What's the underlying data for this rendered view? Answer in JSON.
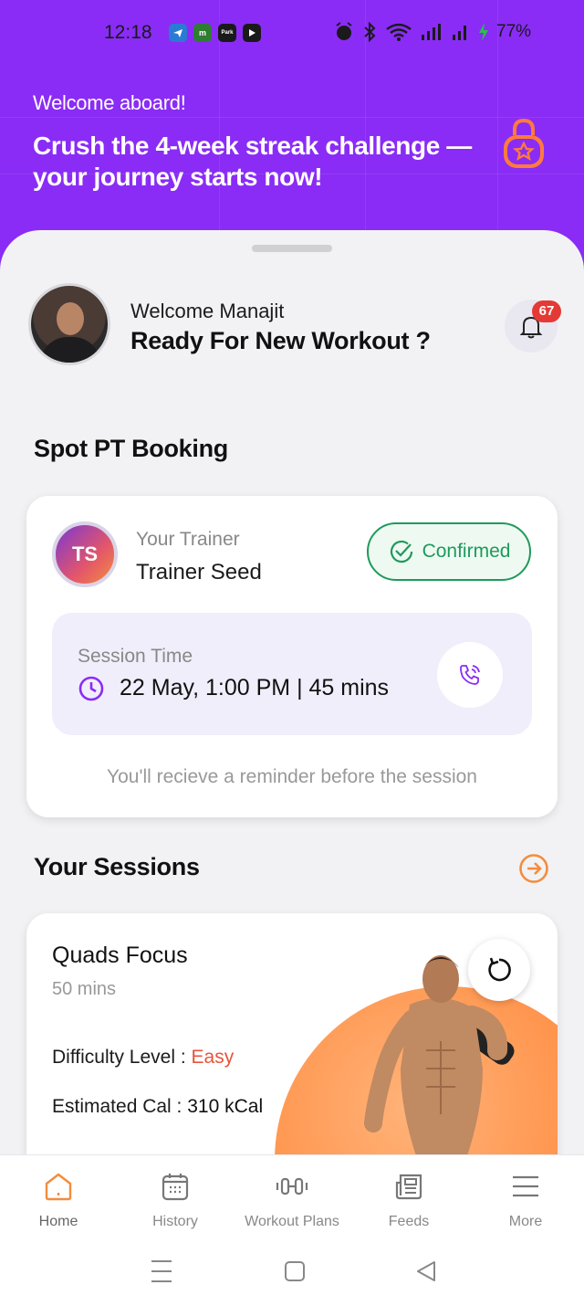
{
  "status_bar": {
    "time": "12:18",
    "battery": "77%",
    "app_icons": [
      "telegram-icon",
      "m-app-icon",
      "park-app-icon",
      "youtube-icon"
    ],
    "app_icon_letters": [
      "",
      "m",
      "Park",
      ""
    ]
  },
  "header": {
    "welcome_small": "Welcome aboard!",
    "welcome_big": "Crush the 4-week streak challenge — your journey starts now!",
    "background": "#8a2cf5",
    "badge_icon": "lock-badge-icon"
  },
  "greeting": {
    "name_line": "Welcome Manajit",
    "title": "Ready For New Workout ?",
    "notification_count": "67"
  },
  "spot_pt": {
    "section_title": "Spot PT Booking",
    "trainer_initials": "TS",
    "trainer_label": "Your Trainer",
    "trainer_name": "Trainer Seed",
    "status": "Confirmed",
    "session_label": "Session Time",
    "session_time": "22 May, 1:00 PM | 45 mins",
    "reminder": "You'll recieve a reminder before the session",
    "accent": "#1e9a5b"
  },
  "sessions": {
    "section_title": "Your Sessions",
    "card": {
      "title": "Quads Focus",
      "duration": "50 mins",
      "difficulty_label": "Difficulty Level : ",
      "difficulty_value": "Easy",
      "calories_label": "Estimated Cal : ",
      "calories_value": "310 kCal"
    },
    "accent": "#f58c3d"
  },
  "bottom_nav": {
    "items": [
      {
        "label": "Home",
        "icon": "home-icon"
      },
      {
        "label": "History",
        "icon": "calendar-icon"
      },
      {
        "label": "Workout Plans",
        "icon": "dumbbell-icon"
      },
      {
        "label": "Feeds",
        "icon": "newspaper-icon"
      },
      {
        "label": "More",
        "icon": "menu-icon"
      }
    ],
    "active": "Home"
  }
}
